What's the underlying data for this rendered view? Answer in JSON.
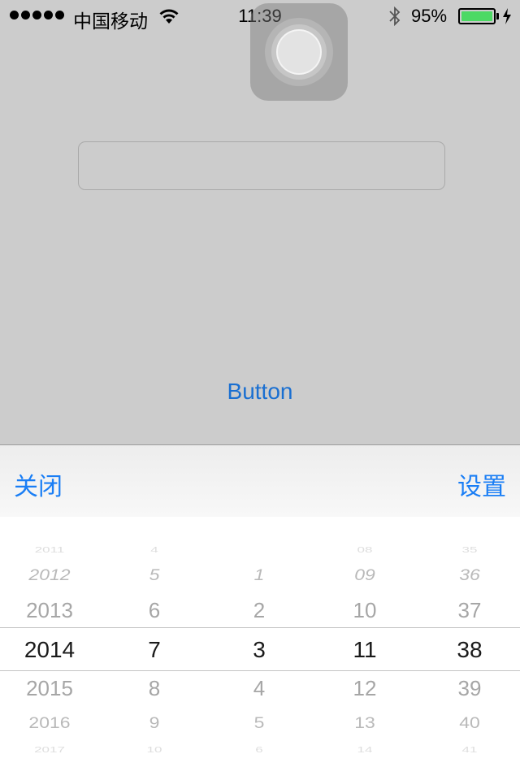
{
  "status_bar": {
    "carrier": "中国移动",
    "time": "11:39",
    "battery_percent": "95%",
    "battery_level": 0.95,
    "signal_bars": 5,
    "icons": [
      "wifi-icon",
      "bluetooth-icon",
      "battery-icon",
      "charging-bolt-icon"
    ]
  },
  "assistive_touch": {
    "icon": "assistive-touch-icon"
  },
  "main": {
    "text_field_value": "",
    "button_label": "Button"
  },
  "picker_toolbar": {
    "close_label": "关闭",
    "set_label": "设置"
  },
  "picker": {
    "columns": [
      {
        "name": "year",
        "rows": [
          "2011",
          "2012",
          "2013",
          "2014",
          "2015",
          "2016",
          "2017"
        ]
      },
      {
        "name": "month",
        "rows": [
          "4",
          "5",
          "6",
          "7",
          "8",
          "9",
          "10"
        ]
      },
      {
        "name": "day",
        "rows": [
          "",
          "1",
          "2",
          "3",
          "4",
          "5",
          "6"
        ]
      },
      {
        "name": "hour",
        "rows": [
          "08",
          "09",
          "10",
          "11",
          "12",
          "13",
          "14"
        ]
      },
      {
        "name": "minute",
        "rows": [
          "35",
          "36",
          "37",
          "38",
          "39",
          "40",
          "41"
        ]
      }
    ],
    "selected": {
      "year": "2014",
      "month": "7",
      "day": "3",
      "hour": "11",
      "minute": "38"
    }
  },
  "colors": {
    "background": "#cccccc",
    "accent_blue": "#1a7ef5",
    "button_blue": "#1a6fd1",
    "battery_green": "#4cd964"
  }
}
